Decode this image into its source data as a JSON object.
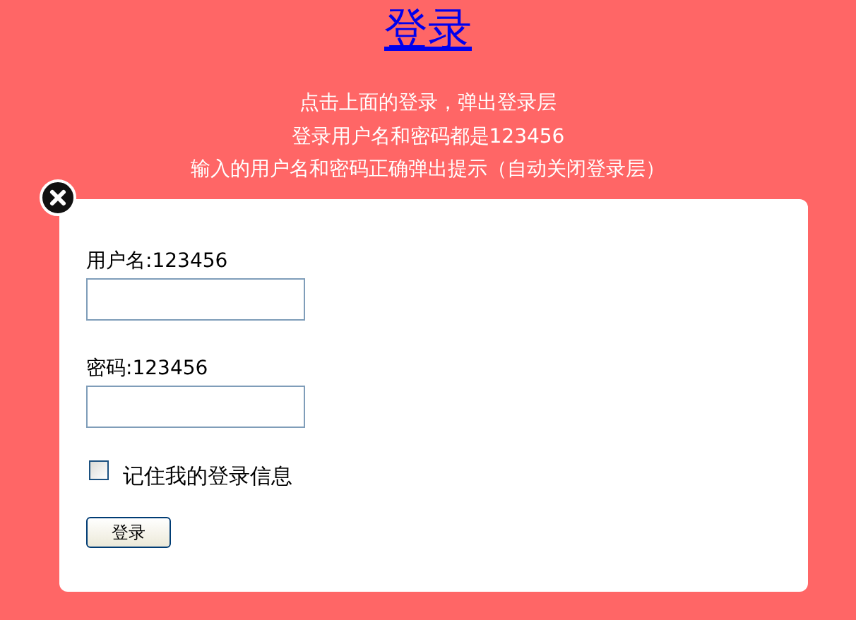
{
  "title_link": "登录",
  "notes": [
    "点击上面的登录，弹出登录层",
    "登录用户名和密码都是123456",
    "输入的用户名和密码正确弹出提示（自动关闭登录层）"
  ],
  "dialog": {
    "username_label": "用户名:123456",
    "password_label": "密码:123456",
    "remember": {
      "label": "记住我的登录信息",
      "checked": false
    },
    "submit": "登录"
  }
}
